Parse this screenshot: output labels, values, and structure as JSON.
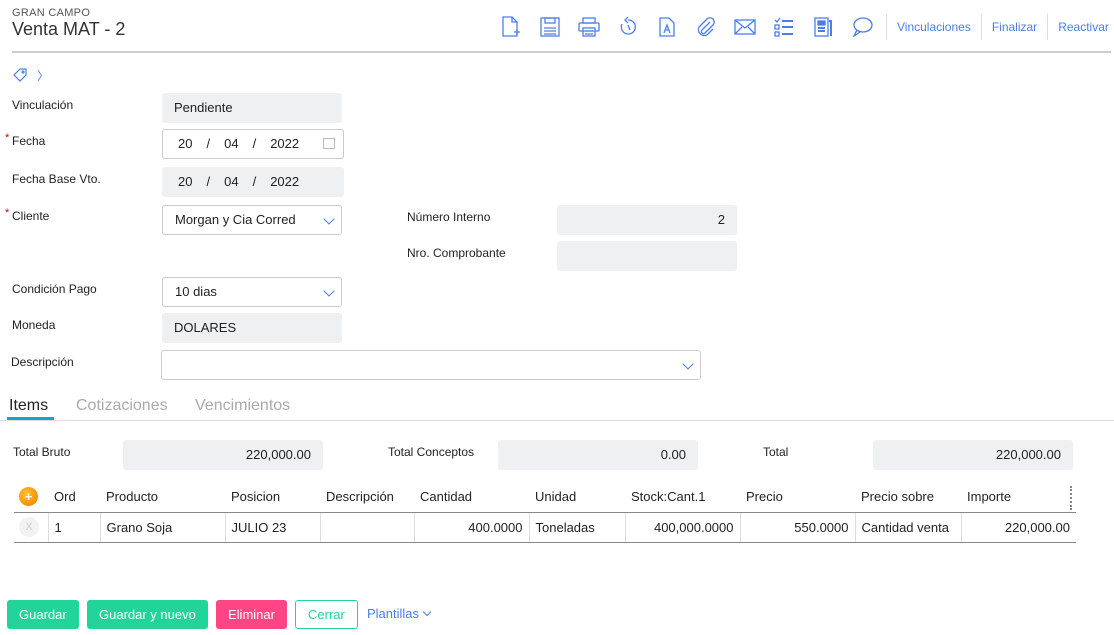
{
  "header": {
    "company": "GRAN CAMPO",
    "title": "Venta MAT - 2"
  },
  "toolbar": {
    "icons": [
      "new-document-icon",
      "save-icon",
      "print-icon",
      "history-icon",
      "document-a-icon",
      "attachment-icon",
      "email-icon",
      "checklist-icon",
      "report-icon",
      "comment-icon"
    ],
    "links": [
      "Vinculaciones",
      "Finalizar",
      "Reactivar"
    ]
  },
  "form": {
    "vinculacion": {
      "label": "Vinculación",
      "value": "Pendiente"
    },
    "fecha": {
      "label": "Fecha",
      "day": "20",
      "month": "04",
      "year": "2022"
    },
    "fecha_base": {
      "label": "Fecha Base Vto.",
      "day": "20",
      "month": "04",
      "year": "2022"
    },
    "cliente": {
      "label": "Cliente",
      "value": "Morgan y Cia Corred"
    },
    "numero_interno": {
      "label": "Número Interno",
      "value": "2"
    },
    "nro_comprobante": {
      "label": "Nro. Comprobante",
      "value": ""
    },
    "condicion_pago": {
      "label": "Condición Pago",
      "value": "10 dias"
    },
    "moneda": {
      "label": "Moneda",
      "value": "DOLARES"
    },
    "descripcion": {
      "label": "Descripción",
      "value": ""
    },
    "sep": "/"
  },
  "tabs": [
    "Items",
    "Cotizaciones",
    "Vencimientos"
  ],
  "totals": {
    "bruto_label": "Total Bruto",
    "bruto": "220,000.00",
    "conceptos_label": "Total Conceptos",
    "conceptos": "0.00",
    "total_label": "Total",
    "total": "220,000.00"
  },
  "table": {
    "columns": [
      "Ord",
      "Producto",
      "Posicion",
      "Descripción",
      "Cantidad",
      "Unidad",
      "Stock:Cant.1",
      "Precio",
      "Precio sobre",
      "Importe"
    ],
    "rows": [
      [
        "1",
        "Grano Soja",
        "JULIO 23",
        "",
        "400.0000",
        "Toneladas",
        "400,000.0000",
        "550.0000",
        "Cantidad venta",
        "220,000.00"
      ]
    ],
    "remove": "X"
  },
  "footer": {
    "guardar": "Guardar",
    "guardar_nuevo": "Guardar y nuevo",
    "eliminar": "Eliminar",
    "cerrar": "Cerrar",
    "plantillas": "Plantillas"
  }
}
